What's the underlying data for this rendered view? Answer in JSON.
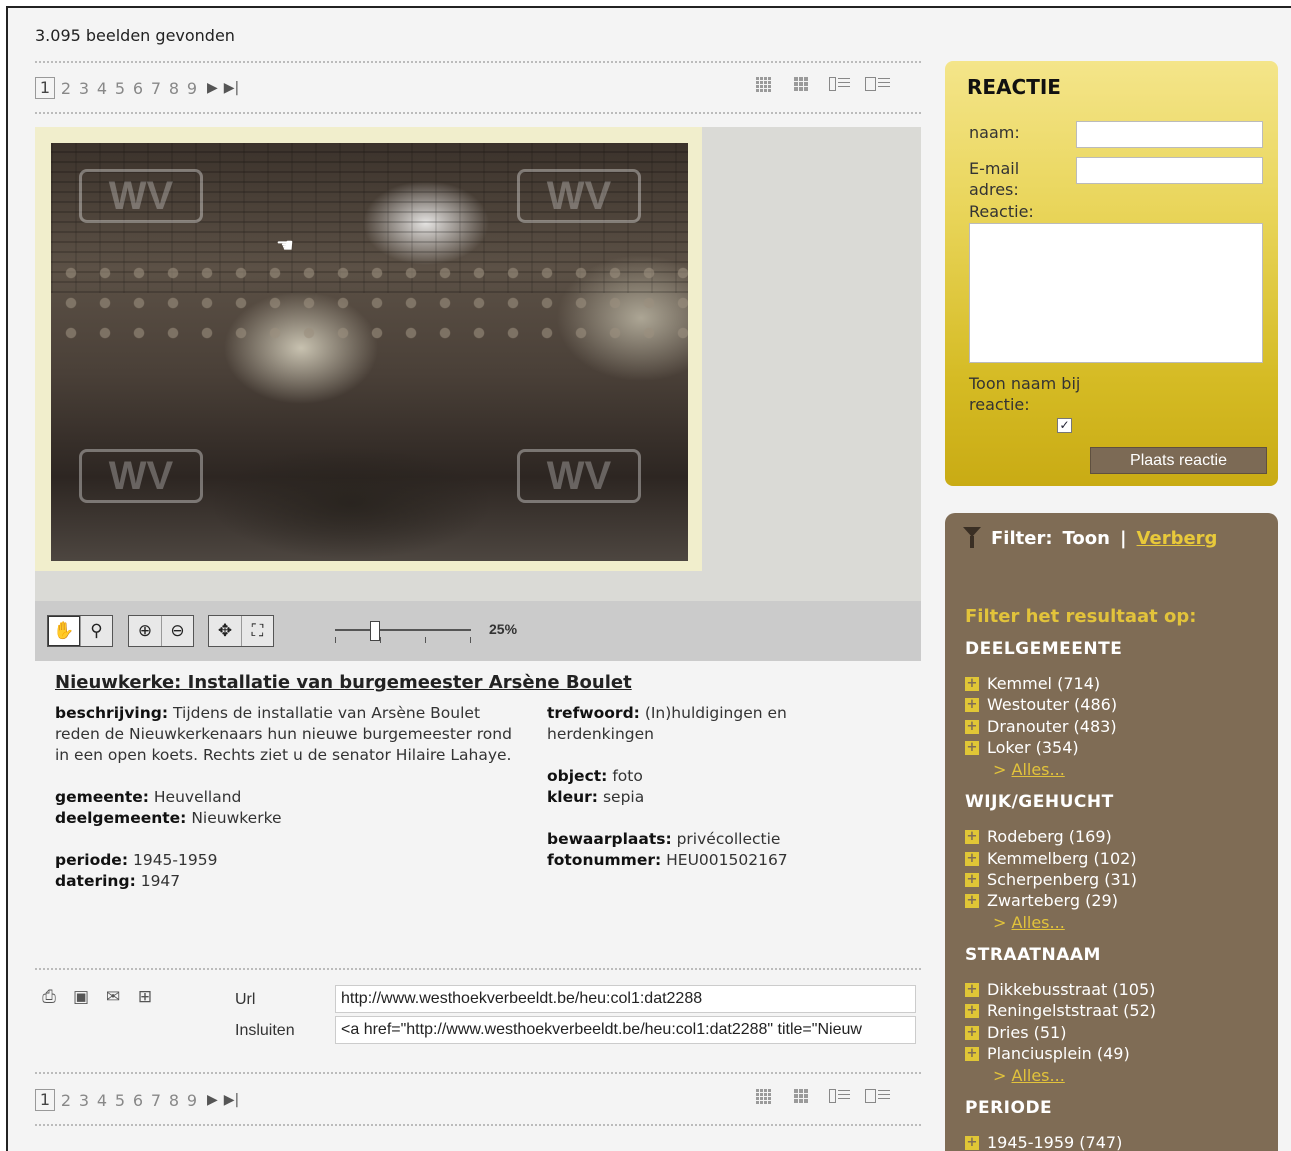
{
  "results_count": "3.095 beelden gevonden",
  "pager": {
    "current": "1",
    "pages": [
      "2",
      "3",
      "4",
      "5",
      "6",
      "7",
      "8",
      "9"
    ],
    "next_glyph": "▶",
    "last_glyph": "▶|"
  },
  "view_modes": [
    "grid-small-icon",
    "grid-large-icon",
    "list-icon",
    "detail-icon"
  ],
  "watermark": "WV",
  "viewer_tools": [
    "pan-hand-icon",
    "magnifier-icon",
    "zoom-in-icon",
    "zoom-out-icon",
    "move-icon",
    "fit-icon"
  ],
  "zoom": {
    "label": "25%",
    "value_percent": 25
  },
  "image": {
    "title": "Nieuwkerke: Installatie van burgemeester Arsène Boulet",
    "beschrijving_label": "beschrijving:",
    "beschrijving": "Tijdens de installatie van Arsène Boulet reden de Nieuwkerkenaars hun nieuwe burgemeester rond in een open koets. Rechts ziet u de senator Hilaire Lahaye.",
    "gemeente_label": "gemeente:",
    "gemeente": "Heuvelland",
    "deelgemeente_label": "deelgemeente:",
    "deelgemeente": "Nieuwkerke",
    "periode_label": "periode:",
    "periode": "1945-1959",
    "datering_label": "datering:",
    "datering": "1947",
    "trefwoord_label": "trefwoord:",
    "trefwoord": "(In)huldigingen en herdenkingen",
    "object_label": "object:",
    "object": "foto",
    "kleur_label": "kleur:",
    "kleur": "sepia",
    "bewaarplaats_label": "bewaarplaats:",
    "bewaarplaats": "privécollectie",
    "fotonummer_label": "fotonummer:",
    "fotonummer": "HEU001502167"
  },
  "share": {
    "icons": [
      "print-icon",
      "save-icon",
      "email-icon",
      "add-icon"
    ],
    "url_label": "Url",
    "url_value": "http://www.westhoekverbeeldt.be/heu:col1:dat2288",
    "embed_label": "Insluiten",
    "embed_value": "<a href=\"http://www.westhoekverbeeldt.be/heu:col1:dat2288\" title=\"Nieuw"
  },
  "reactie": {
    "title": "REACTIE",
    "naam_label": "naam:",
    "email_label_1": "E-mail",
    "email_label_2": "adres:",
    "reactie_label": "Reactie:",
    "toon_label_1": "Toon naam bij",
    "toon_label_2": "reactie:",
    "toon_checked": true,
    "check_glyph": "✓",
    "submit_label": "Plaats reactie"
  },
  "filter": {
    "label": "Filter:",
    "toon": "Toon",
    "separator": "|",
    "verberg": "Verberg",
    "subtitle": "Filter het resultaat op:",
    "alles": "Alles...",
    "alles_prefix": ">",
    "sections": [
      {
        "title": "DEELGEMEENTE",
        "items": [
          "Kemmel (714)",
          "Westouter (486)",
          "Dranouter (483)",
          "Loker (354)"
        ]
      },
      {
        "title": "WIJK/GEHUCHT",
        "items": [
          "Rodeberg (169)",
          "Kemmelberg (102)",
          "Scherpenberg (31)",
          "Zwarteberg (29)"
        ]
      },
      {
        "title": "STRAATNAAM",
        "items": [
          "Dikkebusstraat (105)",
          "Reningelststraat (52)",
          "Dries (51)",
          "Planciusplein (49)"
        ]
      },
      {
        "title": "PERIODE",
        "items": [
          "1945-1959 (747)"
        ]
      }
    ]
  },
  "colors": {
    "reactie_gold": "#d5bb24",
    "filter_brown": "#7f6c55",
    "filter_accent": "#e2c33b"
  }
}
